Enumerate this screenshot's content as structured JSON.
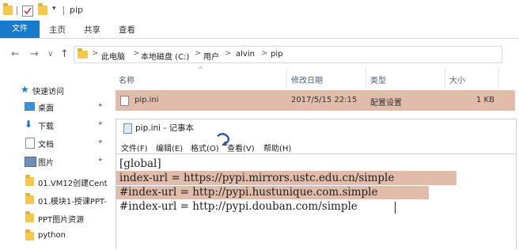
{
  "titlebar": {
    "title": "pip",
    "dropdown_glyph": "▾"
  },
  "ribbon": {
    "tabs": [
      "文件",
      "主页",
      "共享",
      "查看"
    ]
  },
  "nav": {
    "back": "←",
    "forward": "→",
    "dropdown": "∨",
    "up": "↑",
    "breadcrumbs": [
      "此电脑",
      "本地磁盘 (C:)",
      "用户",
      "alvin",
      "pip"
    ],
    "separator": ">"
  },
  "sidebar": {
    "items": [
      {
        "label": "快速访问",
        "icon": "star-icon",
        "pinned": false
      },
      {
        "label": "桌面",
        "icon": "desktop-icon",
        "pinned": true
      },
      {
        "label": "下载",
        "icon": "download-icon",
        "pinned": true
      },
      {
        "label": "文档",
        "icon": "document-icon",
        "pinned": true
      },
      {
        "label": "图片",
        "icon": "picture-icon",
        "pinned": true
      },
      {
        "label": "01.VM12创建Cent",
        "icon": "folder-icon",
        "pinned": false
      },
      {
        "label": "01.模块1-授课PPT-",
        "icon": "folder-icon",
        "pinned": false
      },
      {
        "label": "PPT图片资源",
        "icon": "folder-icon",
        "pinned": false
      },
      {
        "label": "python",
        "icon": "folder-icon",
        "pinned": false
      }
    ],
    "pin_glyph": "✦"
  },
  "columns": {
    "name": "名称",
    "modified": "修改日期",
    "type": "类型",
    "size": "大小",
    "sort_glyph": "^"
  },
  "file": {
    "name": "pip.ini",
    "modified": "2017/5/15 22:15",
    "type": "配置设置",
    "size": "1 KB"
  },
  "notepad": {
    "title": "pip.ini - 记事本",
    "menu": [
      "文件(F)",
      "编辑(E)",
      "格式(O)",
      "查看(V)",
      "帮助(H)"
    ],
    "lines": [
      "[global]",
      "index-url = https://pypi.mirrors.ustc.edu.cn/simple",
      "#index-url = http://pypi.hustunique.com.simple",
      "#index-url = http://pypi.douban.com/simple"
    ]
  },
  "colors": {
    "accent": "#1979ca",
    "highlight": "#e2bcaa",
    "folder": "#f2c94c"
  }
}
